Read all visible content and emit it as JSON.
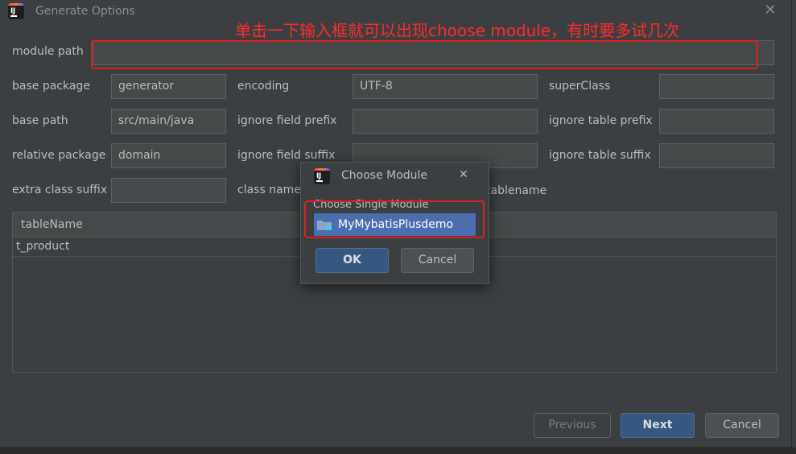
{
  "window": {
    "title": "Generate Options"
  },
  "annotation": {
    "text": "单击一下输入框就可以出现choose module，有时要多试几次"
  },
  "form": {
    "module_path": {
      "label": "module path",
      "value": ""
    },
    "base_package": {
      "label": "base package",
      "value": "generator"
    },
    "encoding": {
      "label": "encoding",
      "value": "UTF-8"
    },
    "super_class": {
      "label": "superClass",
      "value": ""
    },
    "base_path": {
      "label": "base path",
      "value": "src/main/java"
    },
    "ignore_field_prefix": {
      "label": "ignore field prefix",
      "value": ""
    },
    "ignore_table_prefix": {
      "label": "ignore table prefix",
      "value": ""
    },
    "relative_package": {
      "label": "relative package",
      "value": "domain"
    },
    "ignore_field_suffix": {
      "label": "ignore field suffix",
      "value": ""
    },
    "ignore_table_suffix": {
      "label": "ignore table suffix",
      "value": ""
    },
    "extra_class_suffix": {
      "label": "extra class suffix",
      "value": ""
    },
    "class_name_partial": "class name s",
    "tablename_partial": "tablename"
  },
  "table": {
    "header": "tableName",
    "rows": [
      "t_product"
    ]
  },
  "modal": {
    "title": "Choose Module",
    "section_label": "Choose Single Module",
    "items": [
      "MyMybatisPlusdemo"
    ],
    "ok_label": "OK",
    "cancel_label": "Cancel"
  },
  "footer": {
    "previous_label": "Previous",
    "next_label": "Next",
    "cancel_label": "Cancel"
  },
  "colors": {
    "background": "#3c3f41",
    "accent": "#365880",
    "selection": "#4b6eaf",
    "annotation": "#ff2a2a"
  }
}
